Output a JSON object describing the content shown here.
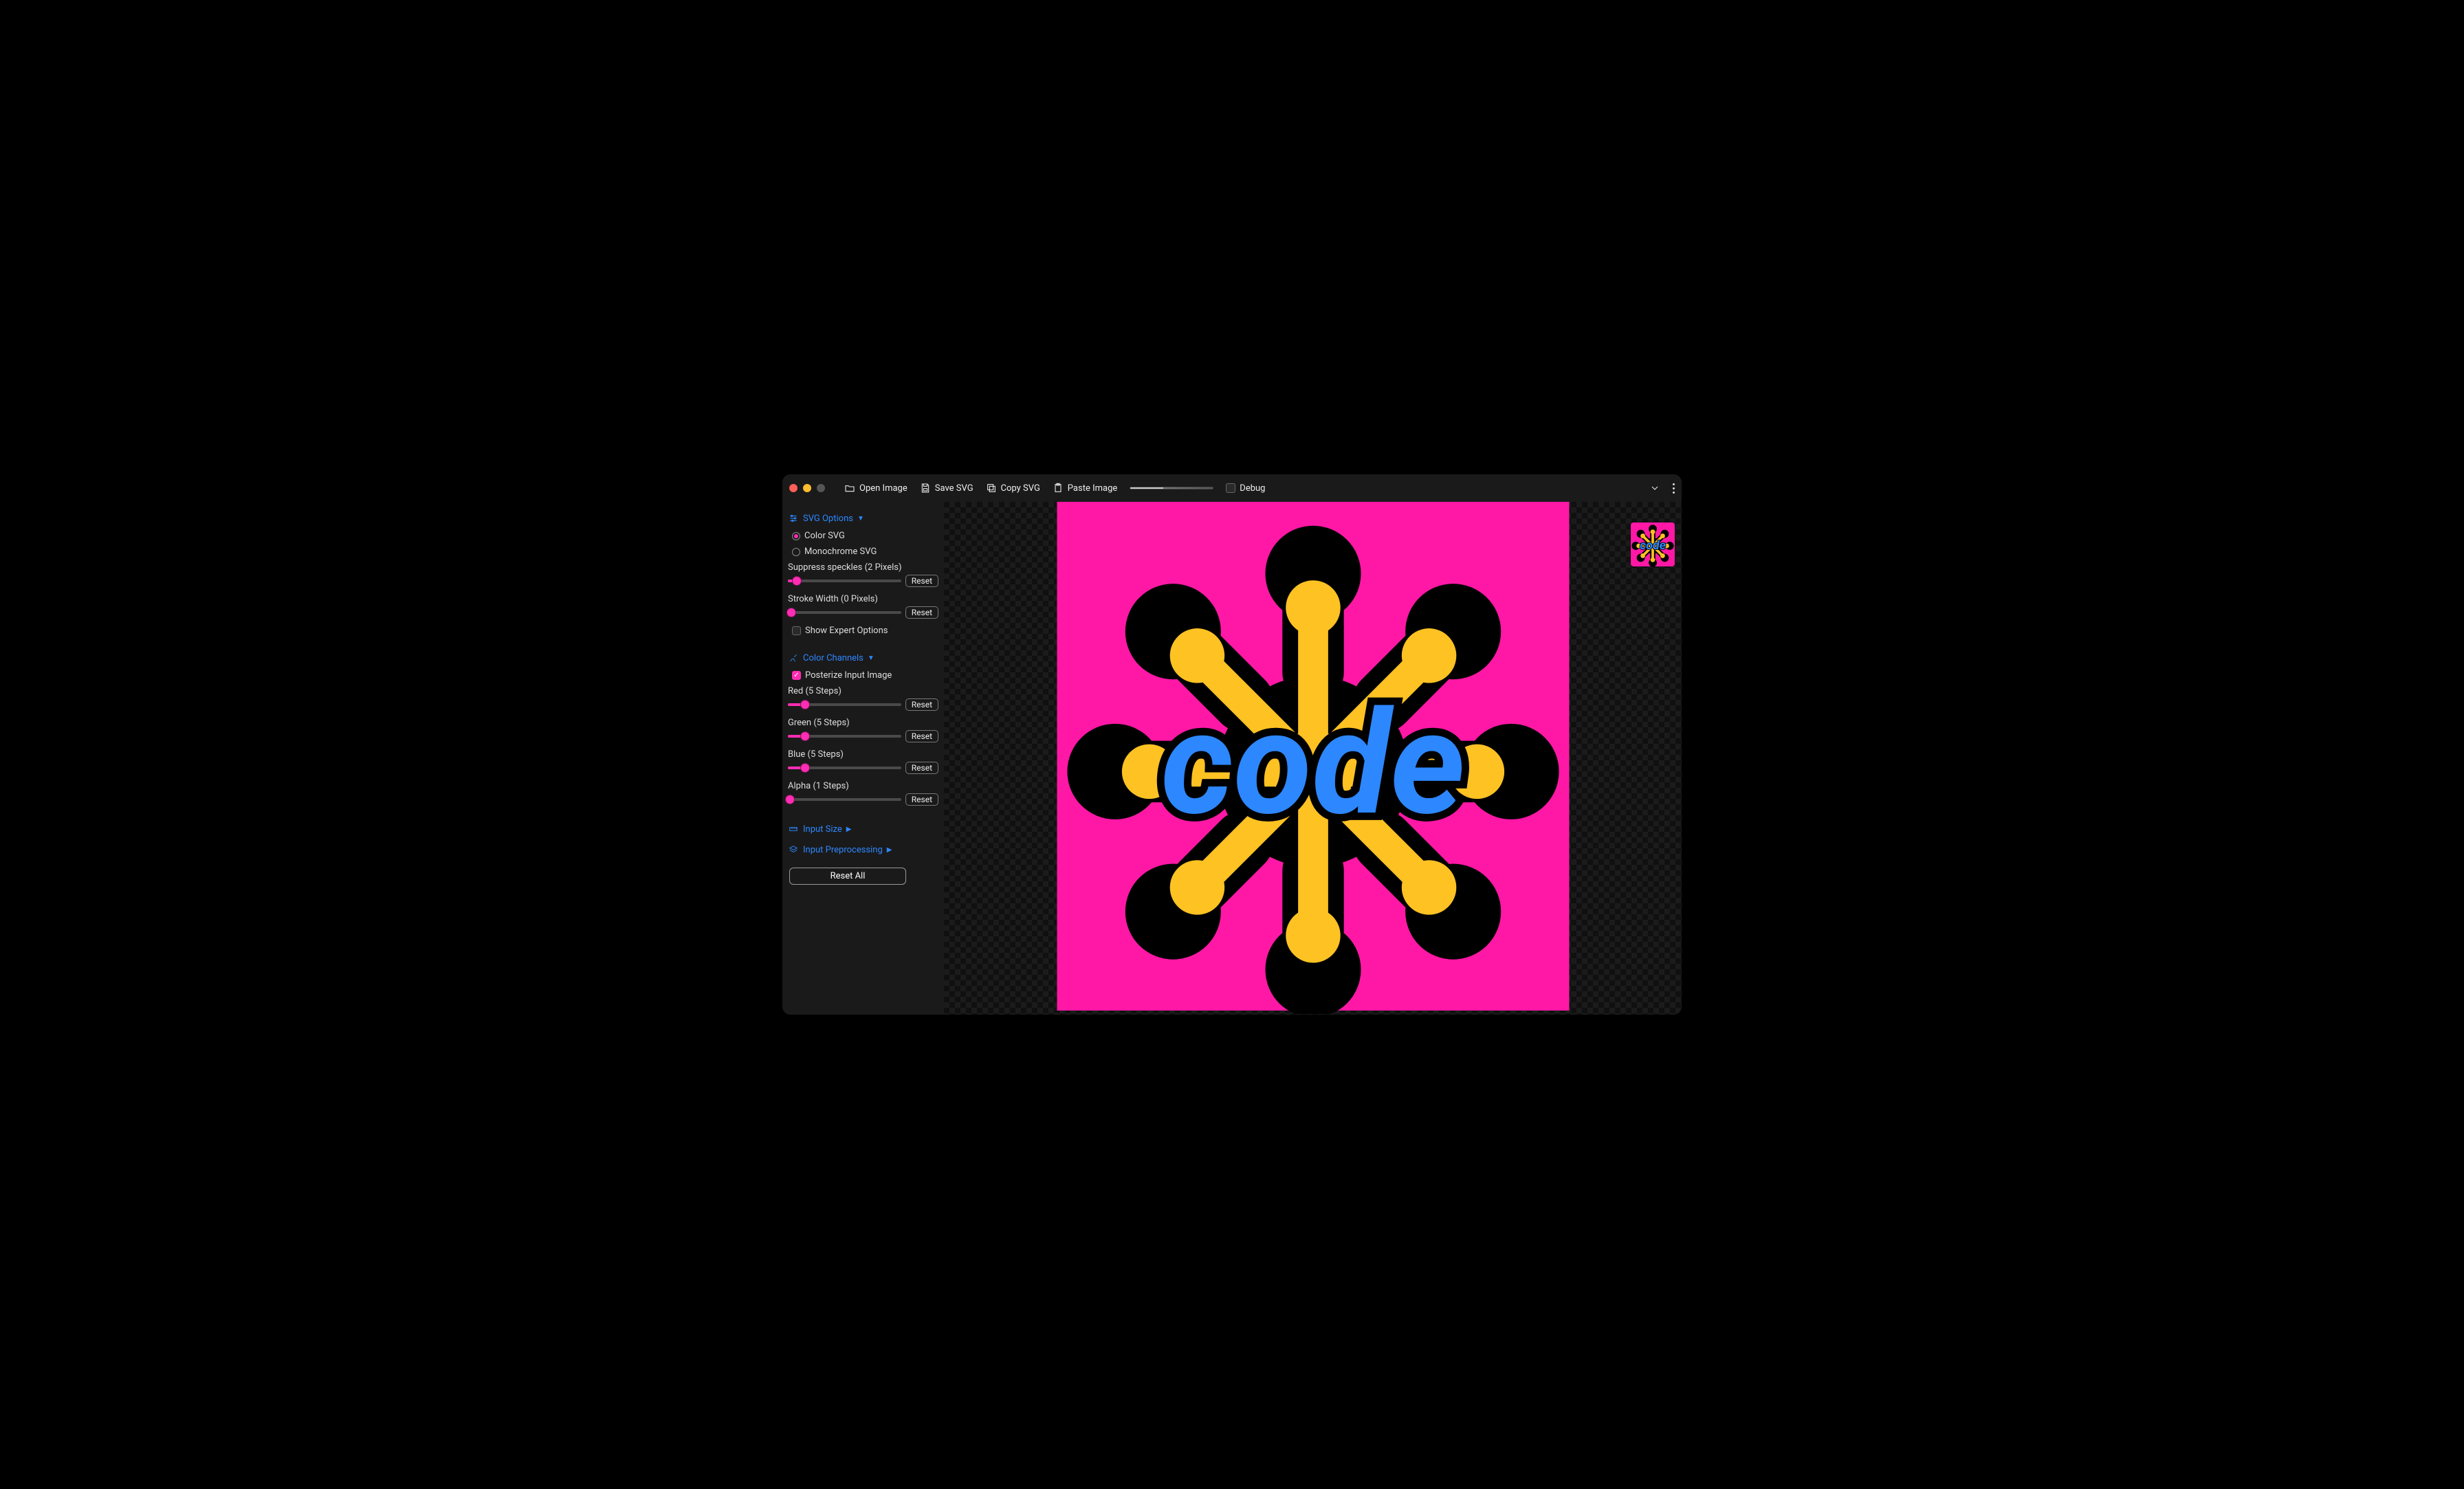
{
  "toolbar": {
    "open_image": "Open Image",
    "save_svg": "Save SVG",
    "copy_svg": "Copy SVG",
    "paste_image": "Paste Image",
    "debug": "Debug"
  },
  "svg_options": {
    "title": "SVG Options",
    "color_svg": "Color SVG",
    "monochrome_svg": "Monochrome SVG",
    "suppress_label": "Suppress speckles (2 Pixels)",
    "suppress_reset": "Reset",
    "suppress_pct": 8,
    "stroke_label": "Stroke Width (0 Pixels)",
    "stroke_reset": "Reset",
    "stroke_pct": 3,
    "show_expert": "Show Expert Options"
  },
  "color_channels": {
    "title": "Color Channels",
    "posterize": "Posterize Input Image",
    "posterize_checked": true,
    "red_label": "Red (5 Steps)",
    "red_reset": "Reset",
    "red_pct": 15,
    "green_label": "Green (5 Steps)",
    "green_reset": "Reset",
    "green_pct": 15,
    "blue_label": "Blue (5 Steps)",
    "blue_reset": "Reset",
    "blue_pct": 15,
    "alpha_label": "Alpha (1 Steps)",
    "alpha_reset": "Reset",
    "alpha_pct": 2
  },
  "input_size": {
    "title": "Input Size"
  },
  "input_pre": {
    "title": "Input Preprocessing"
  },
  "reset_all": "Reset All",
  "image": {
    "bg": "#ff18a6",
    "burst": "#ffc223",
    "outline": "#000000",
    "text": "#2d87ff",
    "word": "code"
  }
}
